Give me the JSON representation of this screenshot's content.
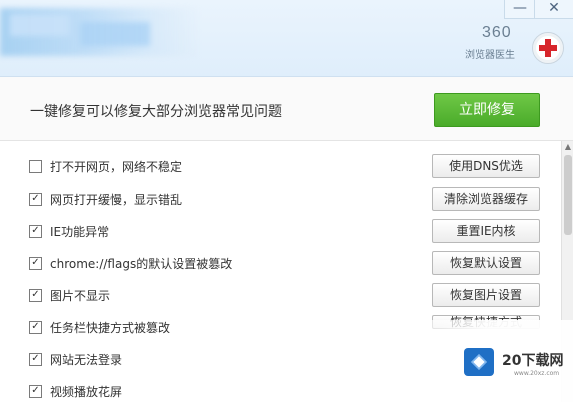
{
  "window": {
    "minimize_icon": "minimize-icon",
    "close_icon": "close-icon",
    "minimize_glyph": "—",
    "close_glyph": "✕"
  },
  "brand": {
    "name": "360",
    "subtitle": "浏览器医生",
    "logo_icon": "red-cross-icon",
    "accent_color": "#d7262c"
  },
  "banner": {
    "title": "一键修复可以修复大部分浏览器常见问题",
    "fix_button": "立即修复",
    "fix_button_color": "#4aab2a"
  },
  "issues": [
    {
      "label": "打不开网页，网络不稳定",
      "checked": false,
      "action": "使用DNS优选"
    },
    {
      "label": "网页打开缓慢，显示错乱",
      "checked": true,
      "action": "清除浏览器缓存"
    },
    {
      "label": "IE功能异常",
      "checked": true,
      "action": "重置IE内核"
    },
    {
      "label": "chrome://flags的默认设置被篡改",
      "checked": true,
      "action": "恢复默认设置"
    },
    {
      "label": "图片不显示",
      "checked": true,
      "action": "恢复图片设置"
    },
    {
      "label": "任务栏快捷方式被篡改",
      "checked": true,
      "action": "恢复快捷方式"
    },
    {
      "label": "网站无法登录",
      "checked": true,
      "action": ""
    },
    {
      "label": "视频播放花屏",
      "checked": true,
      "action": ""
    }
  ],
  "watermark": {
    "text": "20下载网",
    "url": "www.20xz.com"
  }
}
